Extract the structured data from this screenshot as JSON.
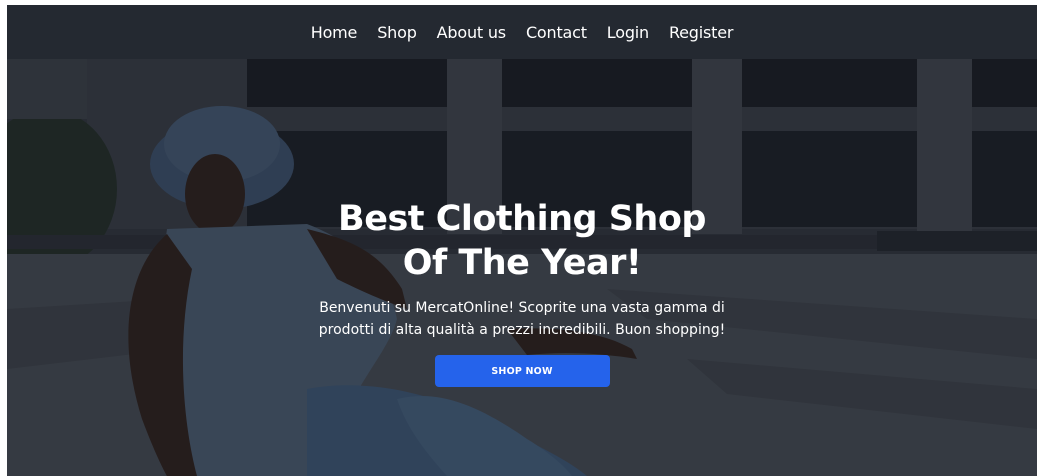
{
  "nav": {
    "items": [
      {
        "label": "Home"
      },
      {
        "label": "Shop"
      },
      {
        "label": "About us"
      },
      {
        "label": "Contact"
      },
      {
        "label": "Login"
      },
      {
        "label": "Register"
      }
    ]
  },
  "hero": {
    "title_line1": "Best Clothing Shop",
    "title_line2": "Of The Year!",
    "description": "Benvenuti su MercatOnline! Scoprite una vasta gamma di prodotti di alta qualità a prezzi incredibili. Buon shopping!",
    "cta_label": "SHOP NOW",
    "image_icon": "woman-in-bucket-hat-photo"
  },
  "colors": {
    "navbar": "#242931",
    "button": "#2563eb",
    "text": "#ffffff"
  }
}
